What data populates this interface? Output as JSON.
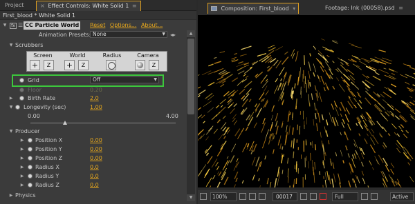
{
  "left_panel": {
    "tabs": [
      {
        "label": "Project"
      },
      {
        "label": "Effect Controls: White Solid 1"
      }
    ],
    "layer_path": "First_blood * White Solid 1",
    "effect": {
      "badge": "fx",
      "name": "CC Particle World",
      "links": [
        "Reset",
        "Options...",
        "About..."
      ]
    },
    "animation_presets": {
      "label": "Animation Presets:",
      "value": "None"
    },
    "scrubbers": {
      "label": "Scrubbers",
      "columns": [
        {
          "title": "Screen",
          "buttons": [
            "+",
            "Z"
          ]
        },
        {
          "title": "World",
          "buttons": [
            "+",
            "Z"
          ]
        },
        {
          "title": "Radius",
          "buttons": [
            "circle"
          ]
        },
        {
          "title": "Camera",
          "buttons": [
            "camera",
            "Z"
          ]
        }
      ]
    },
    "grid": {
      "label": "Grid",
      "value": "Off"
    },
    "faded_row": {
      "label": "Floor",
      "value": "0.20"
    },
    "birth_rate": {
      "label": "Birth Rate",
      "value": "2.0"
    },
    "longevity": {
      "label": "Longevity (sec)",
      "value": "1.00",
      "slider_min": "0.00",
      "slider_max": "4.00"
    },
    "producer": {
      "label": "Producer",
      "props": [
        {
          "label": "Position X",
          "value": "0.00"
        },
        {
          "label": "Position Y",
          "value": "0.00"
        },
        {
          "label": "Position Z",
          "value": "0.00"
        },
        {
          "label": "Radius X",
          "value": "0.0"
        },
        {
          "label": "Radius Y",
          "value": "0.0"
        },
        {
          "label": "Radius Z",
          "value": "0.0"
        }
      ]
    },
    "physics": {
      "label": "Physics"
    }
  },
  "right_panel": {
    "tabs": [
      {
        "label": "Composition: First_blood"
      },
      {
        "label": "Footage: Ink (00058).psd"
      }
    ],
    "viewer_bar": {
      "zoom": "100%",
      "timecode": "00017",
      "resolution": "Full",
      "camera": "Active"
    }
  },
  "colors": {
    "highlight": "#3cc83c",
    "value_accent": "#e8a81c",
    "particle": "#e0a820"
  },
  "icons": [
    "close-icon",
    "panel-menu-icon",
    "stopwatch-icon",
    "disclosure-triangle-icon",
    "composition-icon",
    "camera-icon",
    "snapshot-icon"
  ]
}
